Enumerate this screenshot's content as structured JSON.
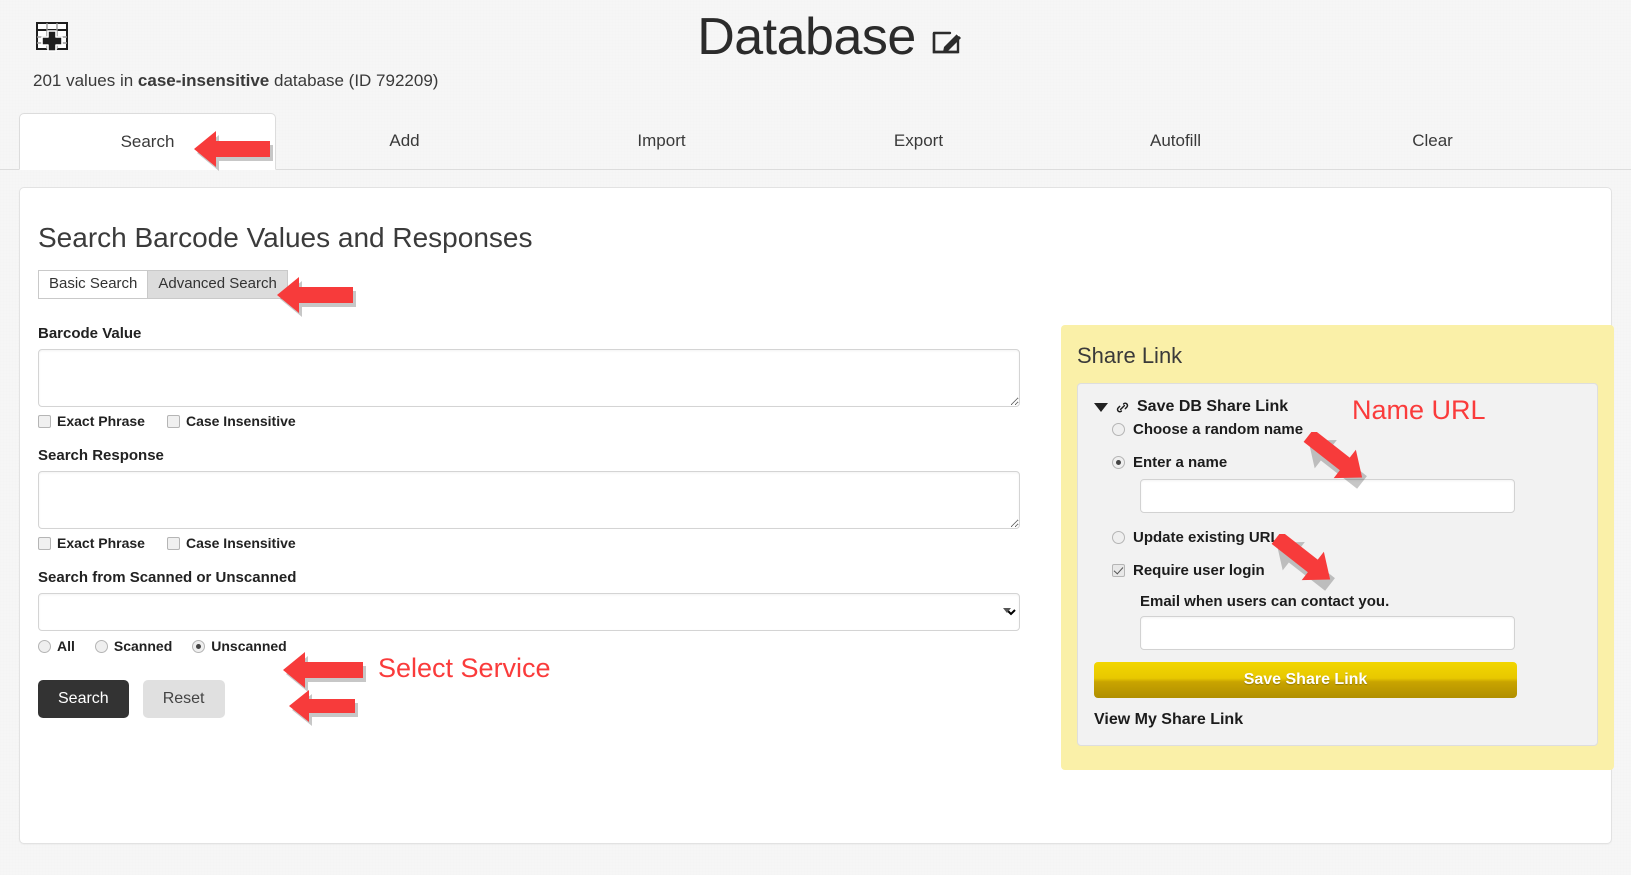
{
  "header": {
    "icon": "database-table-plus-icon",
    "title": "Database",
    "edit_icon": "edit-pencil-icon",
    "subtitle_count": "201 values in ",
    "subtitle_mode": "case-insensitive",
    "subtitle_tail": " database (ID 792209)"
  },
  "tabs": [
    {
      "label": "Search",
      "active": true
    },
    {
      "label": "Add",
      "active": false
    },
    {
      "label": "Import",
      "active": false
    },
    {
      "label": "Export",
      "active": false
    },
    {
      "label": "Autofill",
      "active": false
    },
    {
      "label": "Clear",
      "active": false
    }
  ],
  "search": {
    "section_title": "Search Barcode Values and Responses",
    "modes": [
      {
        "label": "Basic Search",
        "active": false
      },
      {
        "label": "Advanced Search",
        "active": true
      }
    ],
    "barcode_value": {
      "label": "Barcode Value",
      "value": "",
      "options": [
        {
          "label": "Exact Phrase",
          "checked": false
        },
        {
          "label": "Case Insensitive",
          "checked": false
        }
      ]
    },
    "search_response": {
      "label": "Search Response",
      "value": "",
      "options": [
        {
          "label": "Exact Phrase",
          "checked": false
        },
        {
          "label": "Case Insensitive",
          "checked": false
        }
      ]
    },
    "scanned": {
      "label": "Search from Scanned or Unscanned",
      "select_value": "",
      "caret_icon": "chevron-down-icon",
      "radios": [
        {
          "label": "All",
          "selected": false
        },
        {
          "label": "Scanned",
          "selected": false
        },
        {
          "label": "Unscanned",
          "selected": true
        }
      ]
    },
    "submit_label": "Search",
    "reset_label": "Reset"
  },
  "share": {
    "panel_title": "Share Link",
    "disclosure_icon": "triangle-down-icon",
    "link_icon": "chain-link-icon",
    "save_db_label": "Save DB Share Link",
    "options": [
      {
        "label": "Choose a random name",
        "selected": false
      },
      {
        "label": "Enter a name",
        "selected": true
      },
      {
        "label": "Update existing URL",
        "selected": false
      }
    ],
    "name_input_value": "",
    "require_login": {
      "label": "Require user login",
      "checked": true
    },
    "email_note": "Email when users can contact you.",
    "email_input_value": "",
    "save_button_label": "Save Share Link",
    "view_link_label": "View My Share Link"
  },
  "annotations": [
    {
      "name": "search-tab-arrow",
      "text": ""
    },
    {
      "name": "advanced-search-arrow",
      "text": ""
    },
    {
      "name": "select-service-label",
      "text": "Select Service"
    },
    {
      "name": "unscanned-arrow",
      "text": ""
    },
    {
      "name": "name-url-label",
      "text": "Name URL"
    }
  ],
  "colors": {
    "annotation_red": "#fa3b3b",
    "share_panel_yellow": "#faf0a8",
    "primary_button": "#333333",
    "gold_button": "#e8c800"
  }
}
